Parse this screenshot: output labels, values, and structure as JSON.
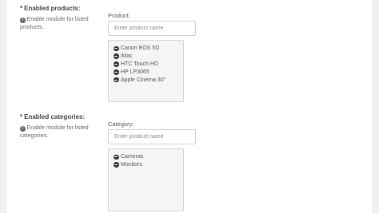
{
  "products": {
    "label": "Enabled products:",
    "help": "Enable module for listed products.",
    "field_label": "Product:",
    "placeholder": "Enter product name",
    "items": [
      {
        "label": "Canon EOS 5D"
      },
      {
        "label": "iMac"
      },
      {
        "label": "HTC Touch HD"
      },
      {
        "label": "HP LP3065"
      },
      {
        "label": "Apple Cinema 30\""
      }
    ]
  },
  "categories": {
    "label": "Enabled categories:",
    "help": "Enable module for listed categories.",
    "field_label": "Category:",
    "placeholder": "Enter product name",
    "items": [
      {
        "label": "Cameras"
      },
      {
        "label": "Monitors"
      }
    ]
  },
  "required_mark": "*",
  "icons": {
    "info": "info-circle-icon",
    "remove": "minus-circle-icon"
  }
}
